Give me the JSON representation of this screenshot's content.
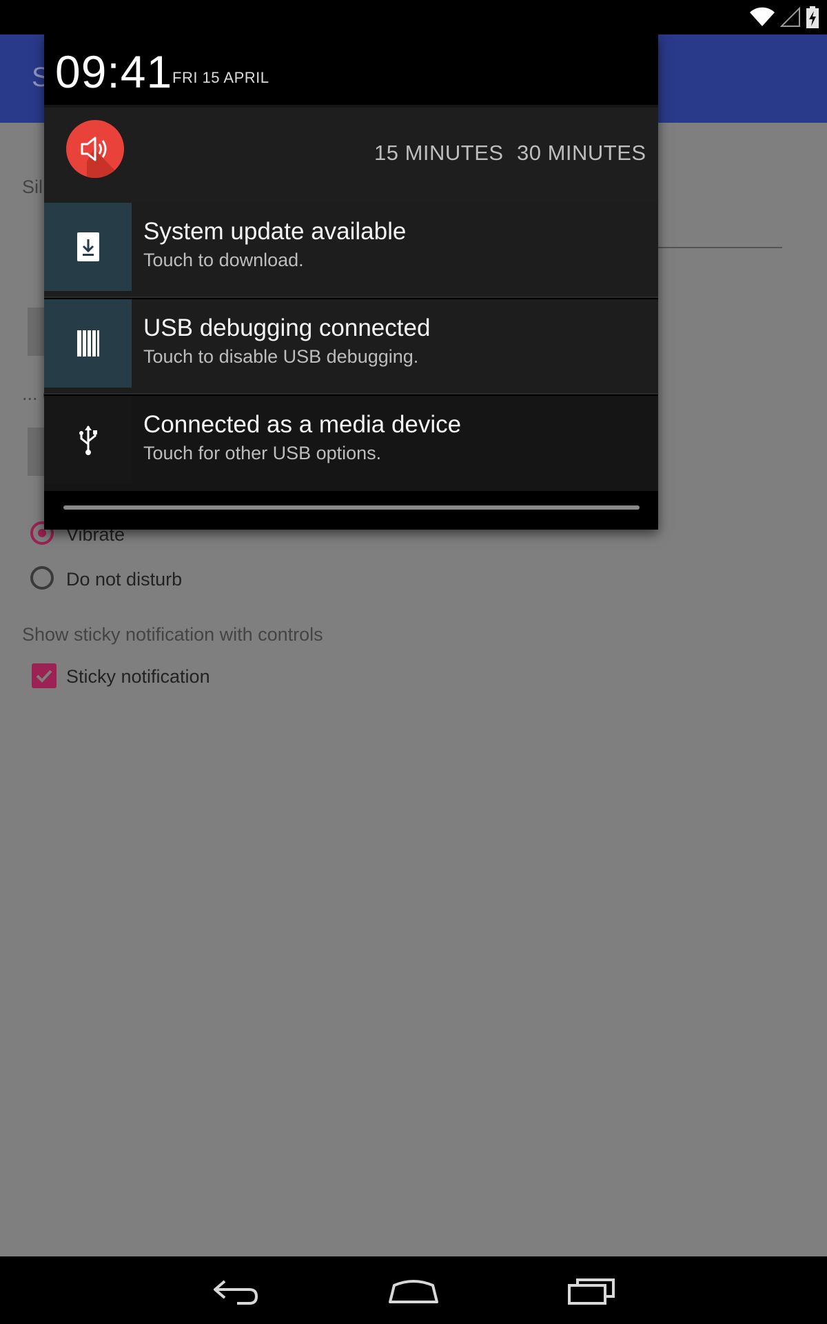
{
  "status_bar": {
    "icons": [
      "wifi-icon",
      "signal-icon",
      "battery-charging-icon"
    ]
  },
  "app": {
    "title_fragment": "S",
    "label_fragment": "Sil",
    "silence_fragment": "... or silence for",
    "radio_options": [
      {
        "label": "Vibrate",
        "checked": true
      },
      {
        "label": "Do not disturb",
        "checked": false
      }
    ],
    "sticky_heading": "Show sticky notification with controls",
    "sticky_checkbox_label": "Sticky notification",
    "sticky_checked": true,
    "accent_color": "#e91e63",
    "appbar_color": "#3f51b5"
  },
  "shade": {
    "clock": "09:41",
    "date": "FRI 15 APRIL",
    "zen": {
      "icon": "volume-icon",
      "icon_color": "#f44336",
      "options": [
        "15 MINUTES",
        "30 MINUTES"
      ]
    },
    "notifications": [
      {
        "title": "System update available",
        "text": "Touch to download.",
        "icon": "system-update-icon"
      },
      {
        "title": "USB debugging connected",
        "text": "Touch to disable USB debugging.",
        "icon": "usb-debugging-icon"
      },
      {
        "title": "Connected as a media device",
        "text": "Touch for other USB options.",
        "icon": "usb-icon"
      }
    ]
  },
  "nav_bar": {
    "buttons": [
      "back-icon",
      "home-icon",
      "recents-icon"
    ]
  }
}
